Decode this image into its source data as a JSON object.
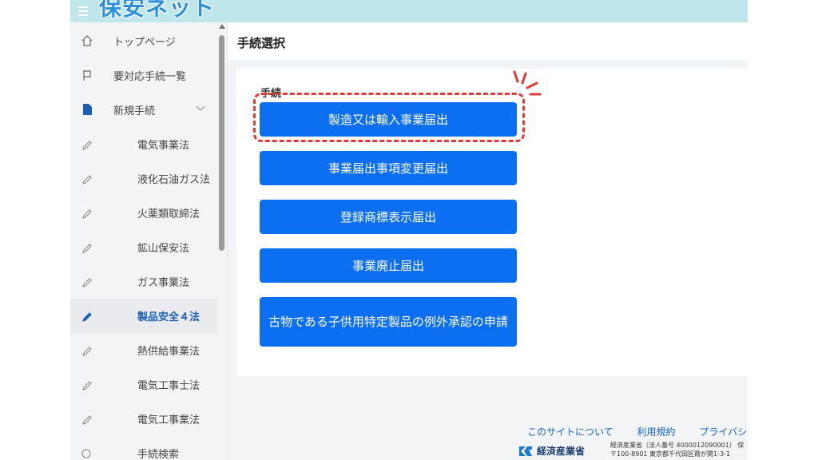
{
  "header": {
    "logo_text": "保安ネット"
  },
  "sidebar": {
    "top_items": [
      {
        "label": "トップページ",
        "icon": "home-icon"
      },
      {
        "label": "要対応手続一覧",
        "icon": "flag-icon"
      },
      {
        "label": "新規手続",
        "icon": "document-icon"
      }
    ],
    "sub_items": [
      {
        "label": "電気事業法"
      },
      {
        "label": "液化石油ガス法"
      },
      {
        "label": "火薬類取締法"
      },
      {
        "label": "鉱山保安法"
      },
      {
        "label": "ガス事業法"
      },
      {
        "label": "製品安全４法",
        "active": true
      },
      {
        "label": "熱供給事業法"
      },
      {
        "label": "電気工事士法"
      },
      {
        "label": "電気工事業法"
      },
      {
        "label": "手続検索"
      }
    ]
  },
  "main": {
    "title": "手続選択",
    "panel_label": "手続",
    "buttons": [
      {
        "label": "製造又は輸入事業届出"
      },
      {
        "label": "事業届出事項変更届出"
      },
      {
        "label": "登録商標表示届出"
      },
      {
        "label": "事業廃止届出"
      },
      {
        "label": "古物である子供用特定製品の例外承認の申請"
      }
    ]
  },
  "footer": {
    "links": [
      "このサイトについて",
      "利用規約",
      "プライバシーポリ"
    ],
    "org_name": "経済産業省",
    "info_line1": "経済産業省（法人番号 4000012090001） 保",
    "info_line2": "〒100-8901 東京都千代田区霞が関1-3-1"
  },
  "colors": {
    "accent": "#0c6ef0",
    "header_bg": "#bfe6ea",
    "highlight": "#e53935"
  }
}
